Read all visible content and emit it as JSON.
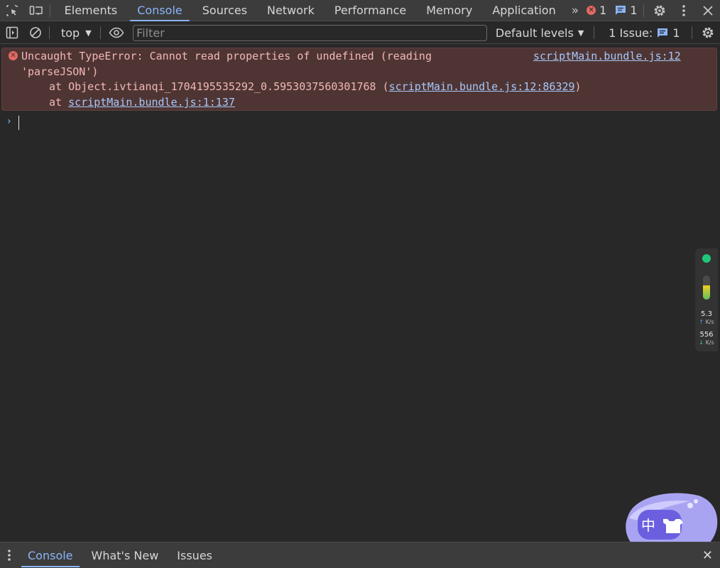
{
  "tabbar": {
    "tabs": [
      "Elements",
      "Console",
      "Sources",
      "Network",
      "Performance",
      "Memory",
      "Application"
    ],
    "active_tab": "Console",
    "more_tabs_glyph": "»",
    "error_count": "1",
    "message_count": "1",
    "icons": [
      "inspect-element-icon",
      "device-toolbar-icon",
      "more-tabs-icon",
      "error-icon",
      "message-icon",
      "settings-gear-icon",
      "kebab-menu-icon",
      "close-icon"
    ]
  },
  "toolbar": {
    "context": "top",
    "filter_placeholder": "Filter",
    "filter_value": "",
    "levels": "Default levels",
    "issues_label": "1 Issue:",
    "issues_count": "1",
    "icons": [
      "sidebar-toggle-icon",
      "clear-console-icon",
      "live-expression-eye-icon",
      "console-settings-gear-icon"
    ]
  },
  "console": {
    "error": {
      "line1": "Uncaught TypeError: Cannot read properties of undefined (reading",
      "line2": "'parseJSON')",
      "source_link": "scriptMain.bundle.js:12",
      "stack1_prefix": "at Object.ivtianqi_1704195535292_0.5953037560301768 (",
      "stack1_link": "scriptMain.bundle.js:12:86329",
      "stack1_suffix": ")",
      "stack2_prefix": "at ",
      "stack2_link": "scriptMain.bundle.js:1:137"
    },
    "prompt_glyph": "›"
  },
  "network_widget": {
    "status_color": "#20c77a",
    "meter_level": 0.6,
    "upload_value": "5.3",
    "upload_unit": "K/s",
    "download_value": "556",
    "download_unit": "K/s"
  },
  "mascot": {
    "label": "中",
    "icon": "tshirt-icon"
  },
  "drawer": {
    "tabs": [
      "Console",
      "What's New",
      "Issues"
    ],
    "active_tab": "Console",
    "close_glyph": "✕"
  },
  "colors": {
    "accent": "#8ab4f8",
    "error_bg": "#4e3534",
    "error_text": "#f2b8b5",
    "link": "#a8c7fa",
    "panel_bg": "#282828",
    "bar_bg": "#3c3c3c"
  }
}
